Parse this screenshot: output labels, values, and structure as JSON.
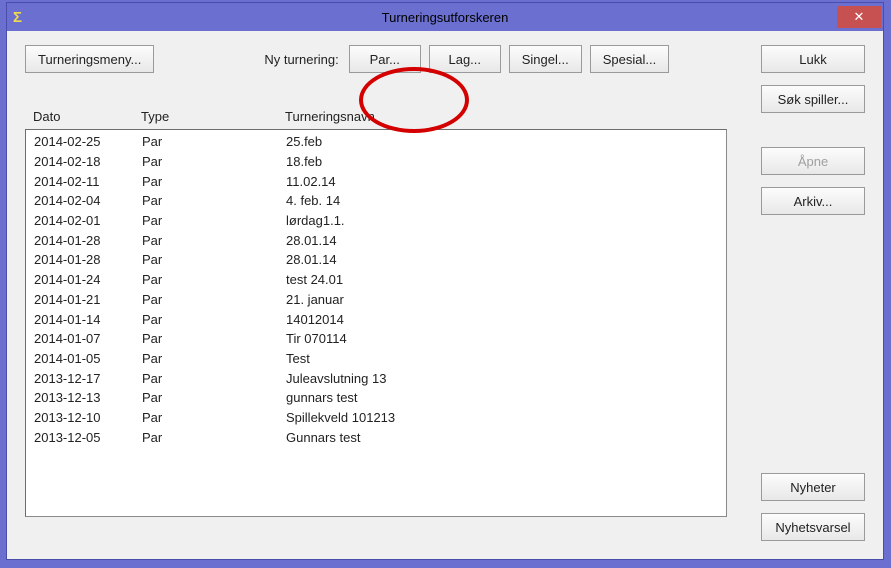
{
  "window": {
    "title": "Turneringsutforskeren",
    "close": "✕"
  },
  "toolbar": {
    "menu": "Turneringsmeny...",
    "new_label": "Ny turnering:",
    "par": "Par...",
    "lag": "Lag...",
    "singel": "Singel...",
    "spesial": "Spesial..."
  },
  "side": {
    "lukk": "Lukk",
    "sok": "Søk spiller...",
    "apne": "Åpne",
    "arkiv": "Arkiv...",
    "nyheter": "Nyheter",
    "nyhetsvarsel": "Nyhetsvarsel"
  },
  "columns": {
    "dato": "Dato",
    "type": "Type",
    "navn": "Turneringsnavn"
  },
  "rows": [
    {
      "dato": "2014-02-25",
      "type": "Par",
      "navn": "25.feb"
    },
    {
      "dato": "2014-02-18",
      "type": "Par",
      "navn": "18.feb"
    },
    {
      "dato": "2014-02-11",
      "type": "Par",
      "navn": "11.02.14"
    },
    {
      "dato": "2014-02-04",
      "type": "Par",
      "navn": "4. feb. 14"
    },
    {
      "dato": "2014-02-01",
      "type": "Par",
      "navn": "lørdag1.1."
    },
    {
      "dato": "2014-01-28",
      "type": "Par",
      "navn": "28.01.14"
    },
    {
      "dato": "2014-01-28",
      "type": "Par",
      "navn": "28.01.14"
    },
    {
      "dato": "2014-01-24",
      "type": "Par",
      "navn": "test 24.01"
    },
    {
      "dato": "2014-01-21",
      "type": "Par",
      "navn": "21. januar"
    },
    {
      "dato": "2014-01-14",
      "type": "Par",
      "navn": "14012014"
    },
    {
      "dato": "2014-01-07",
      "type": "Par",
      "navn": "Tir 070114"
    },
    {
      "dato": "2014-01-05",
      "type": "Par",
      "navn": "Test"
    },
    {
      "dato": "2013-12-17",
      "type": "Par",
      "navn": "Juleavslutning 13"
    },
    {
      "dato": "2013-12-13",
      "type": "Par",
      "navn": "gunnars test"
    },
    {
      "dato": "2013-12-10",
      "type": "Par",
      "navn": "Spillekveld 101213"
    },
    {
      "dato": "2013-12-05",
      "type": "Par",
      "navn": "Gunnars test"
    }
  ]
}
